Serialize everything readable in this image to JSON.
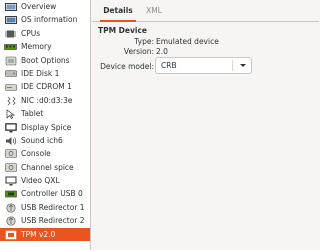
{
  "sidebar": {
    "items": [
      {
        "label": "Overview",
        "icon": "overview-icon"
      },
      {
        "label": "OS information",
        "icon": "os-info-icon"
      },
      {
        "label": "CPUs",
        "icon": "cpu-icon"
      },
      {
        "label": "Memory",
        "icon": "memory-icon"
      },
      {
        "label": "Boot Options",
        "icon": "boot-options-icon"
      },
      {
        "label": "IDE Disk 1",
        "icon": "disk-icon"
      },
      {
        "label": "IDE CDROM 1",
        "icon": "cdrom-icon"
      },
      {
        "label": "NIC :d0:d3:3e",
        "icon": "nic-icon"
      },
      {
        "label": "Tablet",
        "icon": "tablet-icon"
      },
      {
        "label": "Display Spice",
        "icon": "display-icon"
      },
      {
        "label": "Sound ich6",
        "icon": "sound-icon"
      },
      {
        "label": "Console",
        "icon": "console-icon"
      },
      {
        "label": "Channel spice",
        "icon": "channel-icon"
      },
      {
        "label": "Video QXL",
        "icon": "video-icon"
      },
      {
        "label": "Controller USB 0",
        "icon": "controller-icon"
      },
      {
        "label": "USB Redirector 1",
        "icon": "usb-redirector-icon"
      },
      {
        "label": "USB Redirector 2",
        "icon": "usb-redirector-icon"
      },
      {
        "label": "TPM v2.0",
        "icon": "tpm-icon",
        "selected": true
      }
    ]
  },
  "tabs": [
    {
      "label": "Details",
      "active": true
    },
    {
      "label": "XML",
      "active": false
    }
  ],
  "device": {
    "section_title": "TPM Device",
    "type_label": "Type:",
    "type_value": "Emulated device",
    "version_label": "Version:",
    "version_value": "2.0",
    "model_label": "Device model:",
    "model_value": "CRB"
  },
  "colors": {
    "accent": "#e95420",
    "background": "#f6f5f4",
    "sidebar_bg": "#ffffff"
  }
}
